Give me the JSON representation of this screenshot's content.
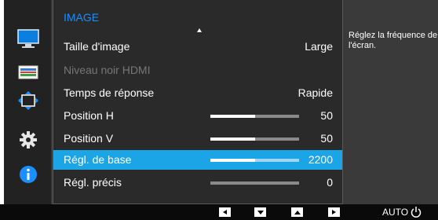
{
  "menu": {
    "title": "IMAGE",
    "items": [
      {
        "label": "Taille d'image",
        "value": "Large",
        "bar": null,
        "disabled": false,
        "selected": false
      },
      {
        "label": "Niveau noir HDMI",
        "value": "",
        "bar": null,
        "disabled": true,
        "selected": false
      },
      {
        "label": "Temps de réponse",
        "value": "Rapide",
        "bar": null,
        "disabled": false,
        "selected": false
      },
      {
        "label": "Position H",
        "value": "50",
        "bar": 0.5,
        "disabled": false,
        "selected": false
      },
      {
        "label": "Position V",
        "value": "50",
        "bar": 0.5,
        "disabled": false,
        "selected": false
      },
      {
        "label": "Régl. de base",
        "value": "2200",
        "bar": 0.5,
        "disabled": false,
        "selected": true
      },
      {
        "label": "Régl. précis",
        "value": "0",
        "bar": 0,
        "disabled": false,
        "selected": false
      }
    ]
  },
  "help_text": "Réglez la fréquence de l'écran.",
  "sidebar": {
    "icons": [
      "monitor-icon",
      "color-bars-icon",
      "screen-size-arrows-icon",
      "settings-gear-icon",
      "info-icon"
    ]
  },
  "bottom_bar": {
    "buttons": [
      "left-arrow-icon",
      "down-arrow-icon",
      "up-arrow-icon",
      "right-arrow-icon"
    ],
    "auto_label": "AUTO",
    "power": "power-icon"
  },
  "colors": {
    "accent": "#1ba4e6",
    "title": "#1a8fff"
  }
}
